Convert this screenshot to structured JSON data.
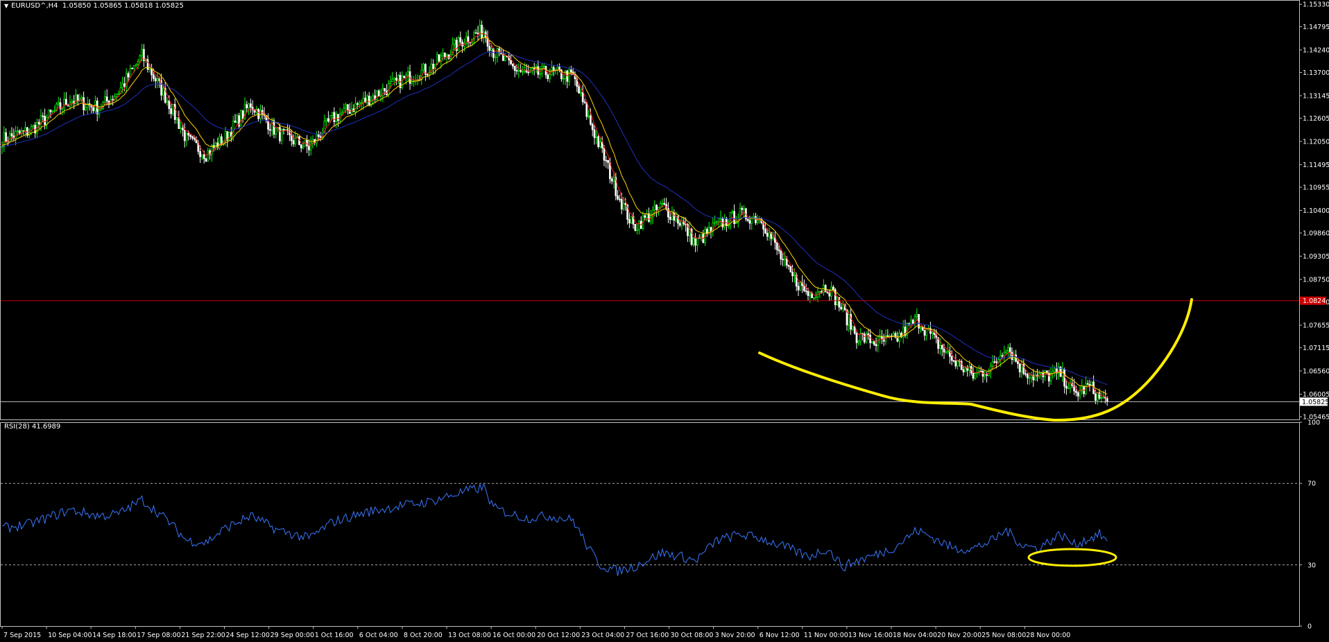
{
  "header": {
    "symbol_title": "EURUSD^,H4",
    "ohlc": "1.05850 1.05865 1.05818 1.05825"
  },
  "rsi_header": {
    "label": "RSI(28)",
    "value": "41.6989"
  },
  "colors": {
    "background": "#000000",
    "axis": "#c0c0c0",
    "bull": "#00ff00",
    "bear": "#ffffff",
    "ma_fast": "#ff2020",
    "ma_mid": "#ffd700",
    "ma_slow": "#2030c0",
    "support": "#cc0000",
    "current": "#c0c0c0",
    "rsi": "#3a78ff",
    "annotation": "#ffee00"
  },
  "chart_data": [
    {
      "type": "candlestick",
      "symbol": "EURUSD^",
      "timeframe": "H4",
      "ylim": [
        1.054,
        1.154
      ],
      "y_ticks": [
        "1.15330",
        "1.14795",
        "1.14240",
        "1.13700",
        "1.13145",
        "1.12605",
        "1.12050",
        "1.11495",
        "1.10955",
        "1.10400",
        "1.09860",
        "1.09305",
        "1.08750",
        "1.08210",
        "1.07655",
        "1.07115",
        "1.06560",
        "1.06005",
        "1.05465"
      ],
      "x_ticks": [
        "7 Sep 2015",
        "10 Sep 04:00",
        "14 Sep 18:00",
        "17 Sep 08:00",
        "21 Sep 22:00",
        "24 Sep 12:00",
        "29 Sep 00:00",
        "1 Oct 16:00",
        "6 Oct 04:00",
        "8 Oct 20:00",
        "13 Oct 08:00",
        "16 Oct 00:00",
        "20 Oct 12:00",
        "23 Oct 04:00",
        "27 Oct 16:00",
        "30 Oct 08:00",
        "3 Nov 20:00",
        "6 Nov 12:00",
        "11 Nov 00:00",
        "13 Nov 16:00",
        "18 Nov 04:00",
        "20 Nov 20:00",
        "25 Nov 08:00",
        "28 Nov 00:00"
      ],
      "price_path": [
        [
          0,
          1.121
        ],
        [
          14,
          1.123
        ],
        [
          35,
          1.1305
        ],
        [
          50,
          1.1285
        ],
        [
          60,
          1.1325
        ],
        [
          72,
          1.141
        ],
        [
          85,
          1.1305
        ],
        [
          95,
          1.121
        ],
        [
          105,
          1.1175
        ],
        [
          115,
          1.1215
        ],
        [
          128,
          1.1295
        ],
        [
          142,
          1.1225
        ],
        [
          158,
          1.119
        ],
        [
          170,
          1.126
        ],
        [
          188,
          1.1305
        ],
        [
          205,
          1.135
        ],
        [
          220,
          1.138
        ],
        [
          238,
          1.145
        ],
        [
          248,
          1.147
        ],
        [
          253,
          1.142
        ],
        [
          262,
          1.1385
        ],
        [
          270,
          1.1365
        ],
        [
          282,
          1.137
        ],
        [
          294,
          1.136
        ],
        [
          302,
          1.126
        ],
        [
          308,
          1.119
        ],
        [
          317,
          1.108
        ],
        [
          325,
          1.1
        ],
        [
          340,
          1.105
        ],
        [
          350,
          1.101
        ],
        [
          357,
          1.096
        ],
        [
          368,
          1.1005
        ],
        [
          380,
          1.103
        ],
        [
          391,
          1.102
        ],
        [
          405,
          1.089
        ],
        [
          415,
          1.084
        ],
        [
          425,
          1.086
        ],
        [
          433,
          1.08
        ],
        [
          440,
          1.074
        ],
        [
          450,
          1.0725
        ],
        [
          460,
          1.073
        ],
        [
          471,
          1.078
        ],
        [
          480,
          1.073
        ],
        [
          490,
          1.068
        ],
        [
          500,
          1.0645
        ],
        [
          510,
          1.0665
        ],
        [
          517,
          1.072
        ],
        [
          525,
          1.066
        ],
        [
          533,
          1.064
        ],
        [
          545,
          1.065
        ],
        [
          552,
          1.06
        ],
        [
          560,
          1.062
        ],
        [
          565,
          1.059
        ],
        [
          569,
          1.0583
        ]
      ],
      "ma_periods": [
        "fast",
        "mid",
        "slow"
      ],
      "support_level": {
        "price": 1.0824,
        "label": "1.0824"
      },
      "current_price": {
        "price": 1.05825,
        "label": "1.05825"
      }
    },
    {
      "type": "line",
      "title": "RSI(28) 41.6989",
      "ylim": [
        0,
        100
      ],
      "y_ticks": [
        "100",
        "70",
        "30",
        "0"
      ],
      "levels": [
        70,
        30
      ],
      "rsi_path": [
        [
          0,
          48
        ],
        [
          14,
          50
        ],
        [
          35,
          57
        ],
        [
          50,
          54
        ],
        [
          60,
          55
        ],
        [
          72,
          62
        ],
        [
          85,
          52
        ],
        [
          95,
          42
        ],
        [
          105,
          41
        ],
        [
          115,
          48
        ],
        [
          128,
          54
        ],
        [
          142,
          47
        ],
        [
          158,
          43
        ],
        [
          170,
          51
        ],
        [
          188,
          56
        ],
        [
          205,
          59
        ],
        [
          220,
          61
        ],
        [
          238,
          66
        ],
        [
          248,
          68
        ],
        [
          253,
          58
        ],
        [
          262,
          55
        ],
        [
          270,
          53
        ],
        [
          282,
          54
        ],
        [
          294,
          52
        ],
        [
          302,
          38
        ],
        [
          308,
          30
        ],
        [
          317,
          27
        ],
        [
          325,
          29
        ],
        [
          340,
          36
        ],
        [
          350,
          34
        ],
        [
          357,
          32
        ],
        [
          368,
          42
        ],
        [
          380,
          45
        ],
        [
          391,
          43
        ],
        [
          405,
          38
        ],
        [
          415,
          34
        ],
        [
          425,
          38
        ],
        [
          433,
          29
        ],
        [
          440,
          32
        ],
        [
          450,
          35
        ],
        [
          460,
          39
        ],
        [
          471,
          47
        ],
        [
          480,
          43
        ],
        [
          490,
          38
        ],
        [
          500,
          38
        ],
        [
          510,
          42
        ],
        [
          517,
          47
        ],
        [
          525,
          40
        ],
        [
          533,
          38
        ],
        [
          545,
          45
        ],
        [
          552,
          40
        ],
        [
          560,
          43
        ],
        [
          565,
          45
        ],
        [
          569,
          41.7
        ]
      ]
    }
  ]
}
